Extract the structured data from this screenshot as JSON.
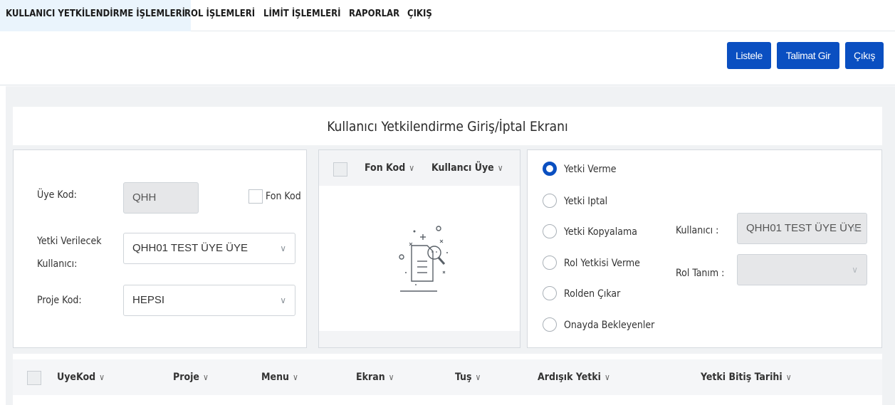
{
  "nav": {
    "items": [
      {
        "label": "KULLANICI YETKİLENDİRME İŞLEMLERİ"
      },
      {
        "label": "ROL İŞLEMLERİ"
      },
      {
        "label": "LİMİT İŞLEMLERİ"
      },
      {
        "label": "RAPORLAR"
      },
      {
        "label": "ÇIKIŞ"
      }
    ]
  },
  "toolbar": {
    "list_label": "Listele",
    "order_label": "Talimat Gir",
    "exit_label": "Çıkış"
  },
  "page": {
    "title": "Kullanıcı Yetkilendirme Giriş/İptal Ekranı"
  },
  "form": {
    "uye_kod_label": "Üye Kod:",
    "uye_kod_value": "QHH",
    "fon_kod_label": "Fon Kod",
    "yetki_kullanici_label_1": "Yetki Verilecek",
    "yetki_kullanici_label_2": "Kullanıcı:",
    "yetki_kullanici_value": "QHH01 TEST ÜYE ÜYE",
    "proje_kod_label": "Proje Kod:",
    "proje_kod_value": "HEPSI"
  },
  "fon_table": {
    "col_fon_kod": "Fon Kod",
    "col_kullanici_uye": "Kullancı Üye"
  },
  "options": {
    "radios": [
      {
        "label": "Yetki Verme",
        "selected": true
      },
      {
        "label": "Yetki Iptal",
        "selected": false
      },
      {
        "label": "Yetki Kopyalama",
        "selected": false
      },
      {
        "label": "Rol Yetkisi Verme",
        "selected": false
      },
      {
        "label": "Rolden Çıkar",
        "selected": false
      },
      {
        "label": "Onayda Bekleyenler",
        "selected": false
      }
    ],
    "kullanici_label": "Kullanıcı :",
    "kullanici_value": "QHH01 TEST ÜYE ÜYE",
    "rol_tanim_label": "Rol Tanım :",
    "rol_tanim_value": ""
  },
  "grid": {
    "columns": [
      {
        "label": "UyeKod"
      },
      {
        "label": "Proje"
      },
      {
        "label": "Menu"
      },
      {
        "label": "Ekran"
      },
      {
        "label": "Tuş"
      },
      {
        "label": "Ardışık Yetki"
      },
      {
        "label": "Yetki Bitiş Tarihi"
      }
    ]
  },
  "colors": {
    "primary": "#0a4fc1",
    "active_tab_bg": "#eaf4fc",
    "workspace_bg": "#f0f2f4"
  }
}
